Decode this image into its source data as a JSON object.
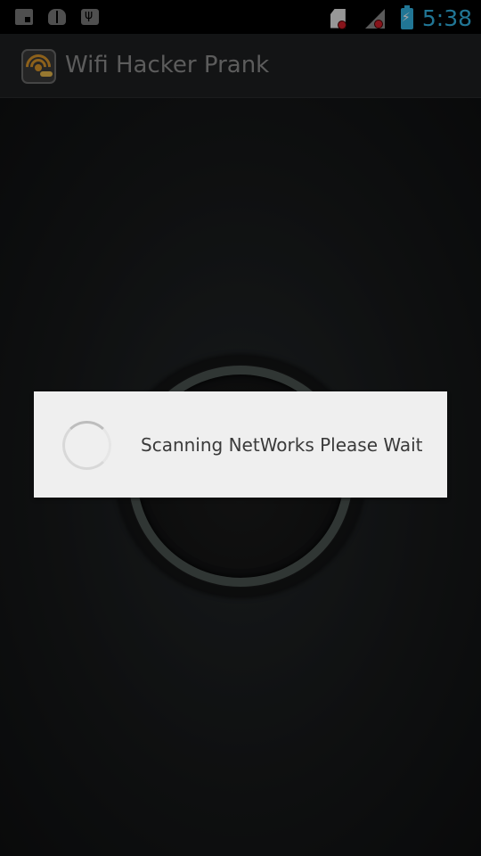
{
  "status_bar": {
    "time": "5:38",
    "left_icons": [
      "notification-icon",
      "bug-icon",
      "usb-icon"
    ],
    "right_icons": [
      "sim-card-icon",
      "signal-icon",
      "battery-charging-icon"
    ],
    "accent_color": "#33b5e5"
  },
  "app_bar": {
    "title": "Wifi Hacker Prank",
    "icon": "wifi-hacker-app-icon"
  },
  "dialog": {
    "message": "Scanning NetWorks Please Wait",
    "indicator": "progress-spinner-icon"
  }
}
